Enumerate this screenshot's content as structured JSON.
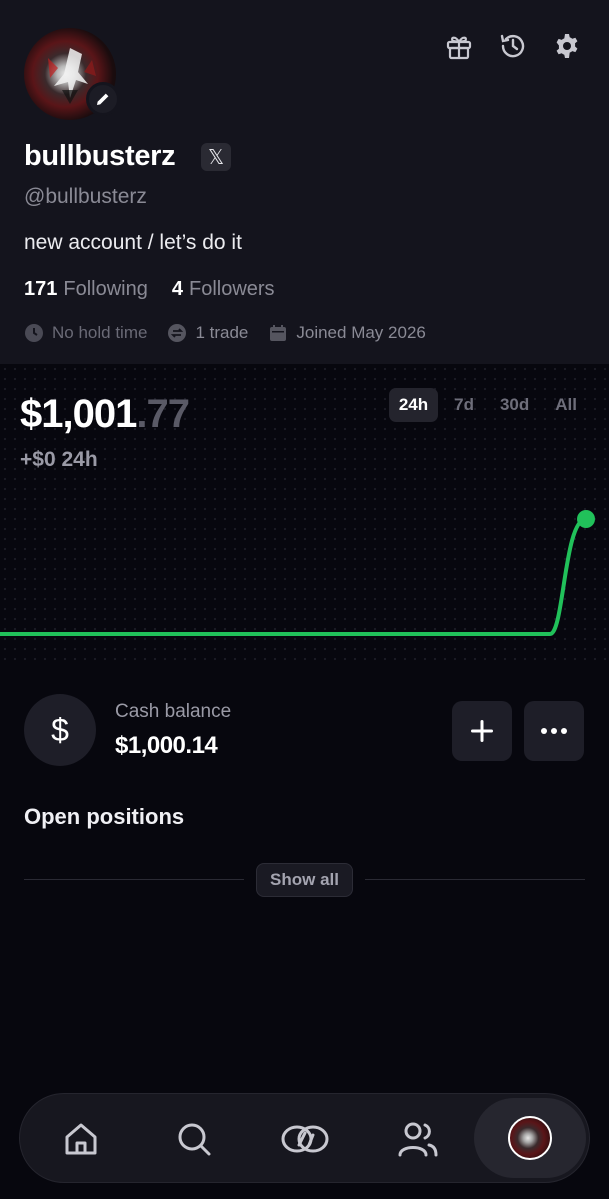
{
  "profile": {
    "display_name": "bullbusterz",
    "social_badge": "𝕏",
    "handle": "@bullbusterz",
    "bio": "new account / let’s do it",
    "following_count": "171",
    "following_label": "Following",
    "followers_count": "4",
    "followers_label": "Followers",
    "meta": {
      "hold_time": "No hold time",
      "trades": "1 trade",
      "joined": "Joined May 2026"
    }
  },
  "portfolio": {
    "value_main": "$1,001",
    "value_cents": ".77",
    "change": "+$0 24h",
    "ranges": [
      "24h",
      "7d",
      "30d",
      "All"
    ],
    "active_range": "24h",
    "line_color": "#21c15a"
  },
  "cash": {
    "symbol": "$",
    "label": "Cash balance",
    "value": "$1,000.14"
  },
  "positions": {
    "title": "Open positions",
    "show_all_label": "Show all"
  },
  "nav": {
    "items": [
      "home-icon",
      "search-icon",
      "coins-icon",
      "users-icon",
      "profile-avatar"
    ],
    "active": "profile-avatar"
  },
  "chart_data": {
    "type": "line",
    "x": [
      "start",
      "end"
    ],
    "series": [
      {
        "values": [
          1000.0,
          1000.0,
          1000.0,
          1001.77
        ]
      }
    ],
    "grid": false
  }
}
